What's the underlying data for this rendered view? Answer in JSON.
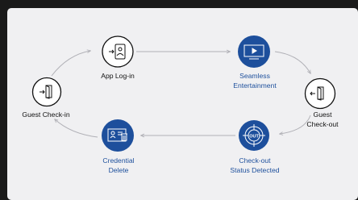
{
  "colors": {
    "background": "#1a1a1a",
    "canvas": "#f0f0f2",
    "accent_blue": "#1d4f9c",
    "node_outline": "#111111",
    "arrow": "#b0b0b6"
  },
  "nodes": [
    {
      "id": "guest-check-in",
      "label": "Guest Check-in",
      "style": "outline",
      "icon": "door-enter-icon"
    },
    {
      "id": "app-log-in",
      "label": "App Log-in",
      "style": "outline",
      "icon": "phone-login-icon"
    },
    {
      "id": "seamless-entertainment",
      "label": "Seamless\nEntertainment",
      "style": "filled",
      "icon": "tv-screen-icon"
    },
    {
      "id": "guest-check-out",
      "label": "Guest Check-out",
      "style": "outline",
      "icon": "door-exit-icon"
    },
    {
      "id": "check-out-status-detected",
      "label": "Check-out\nStatus Detected",
      "style": "filled",
      "icon": "target-out-icon",
      "badge": "OUT"
    },
    {
      "id": "credential-delete",
      "label": "Credential\nDelete",
      "style": "filled",
      "icon": "id-card-delete-icon"
    }
  ]
}
